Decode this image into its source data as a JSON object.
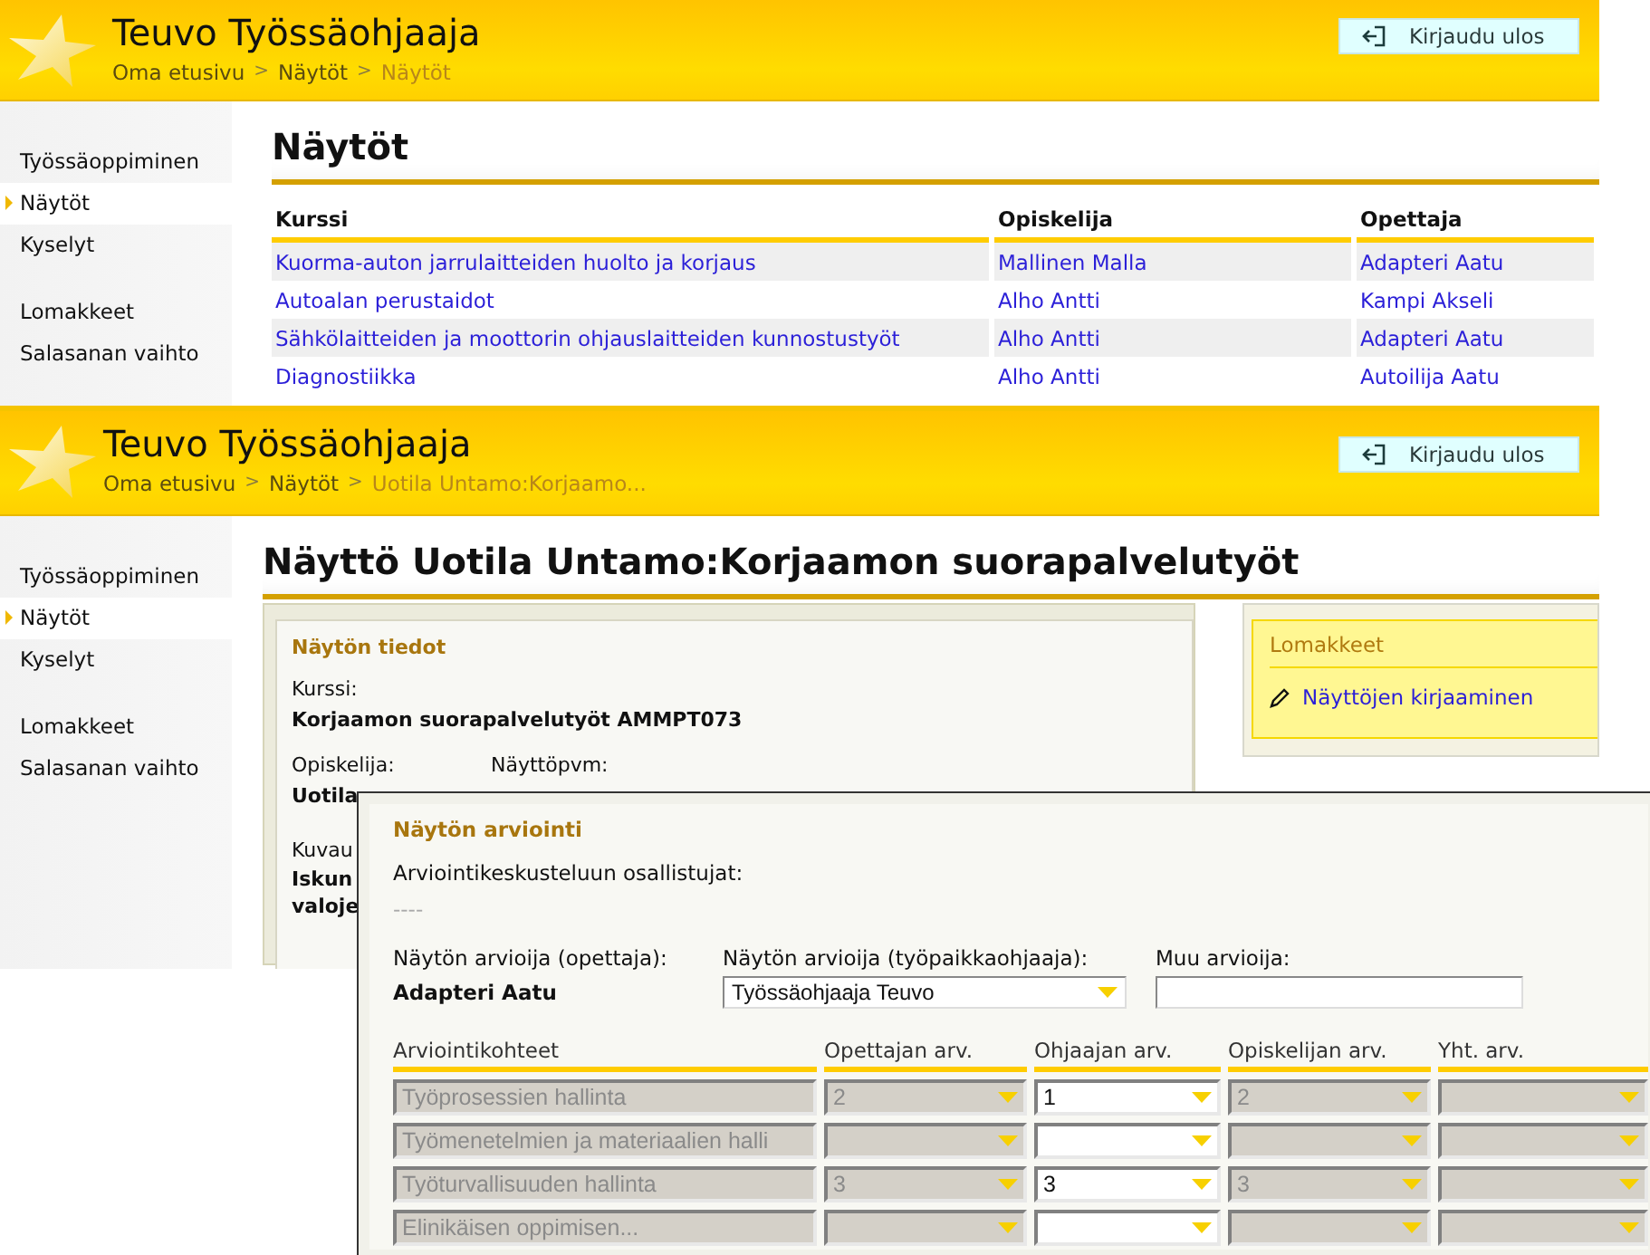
{
  "screens": [
    {
      "kind": "list",
      "header": {
        "title": "Teuvo Työssäohjaaja",
        "breadcrumb": {
          "separator": ">",
          "items": [
            {
              "text": "Oma etusivu",
              "current": false
            },
            {
              "text": "Näytöt",
              "current": false
            },
            {
              "text": "Näytöt",
              "current": true
            }
          ]
        },
        "logout": "Kirjaudu ulos"
      },
      "sidebar": [
        {
          "items": [
            {
              "label": "Työssäoppiminen",
              "selected": false
            },
            {
              "label": "Näytöt",
              "selected": true
            },
            {
              "label": "Kyselyt",
              "selected": false
            }
          ]
        },
        {
          "items": [
            {
              "label": "Lomakkeet",
              "selected": false
            },
            {
              "label": "Salasanan vaihto",
              "selected": false
            }
          ]
        }
      ],
      "page_title": "Näytöt",
      "table": {
        "columns": [
          "Kurssi",
          "Opiskelija",
          "Opettaja"
        ],
        "rows": [
          [
            "Kuorma-auton jarrulaitteiden huolto ja korjaus",
            "Mallinen Malla",
            "Adapteri Aatu"
          ],
          [
            "Autoalan perustaidot",
            "Alho Antti",
            "Kampi Akseli"
          ],
          [
            "Sähkölaitteiden ja moottorin ohjauslaitteiden kunnostustyöt",
            "Alho Antti",
            "Adapteri Aatu"
          ],
          [
            "Diagnostiikka",
            "Alho Antti",
            "Autoilija Aatu"
          ]
        ]
      }
    },
    {
      "kind": "detail",
      "header": {
        "title": "Teuvo Työssäohjaaja",
        "breadcrumb": {
          "separator": ">",
          "items": [
            {
              "text": "Oma etusivu",
              "current": false
            },
            {
              "text": "Näytöt",
              "current": false
            },
            {
              "text": "Uotila Untamo:Korjaamo...",
              "current": true
            }
          ]
        },
        "logout": "Kirjaudu ulos"
      },
      "sidebar": [
        {
          "items": [
            {
              "label": "Työssäoppiminen",
              "selected": false
            },
            {
              "label": "Näytöt",
              "selected": true
            },
            {
              "label": "Kyselyt",
              "selected": false
            }
          ]
        },
        {
          "items": [
            {
              "label": "Lomakkeet",
              "selected": false
            },
            {
              "label": "Salasanan vaihto",
              "selected": false
            }
          ]
        }
      ],
      "page_title": "Näyttö Uotila Untamo:Korjaamon suorapalvelutyöt",
      "info": {
        "title": "Näytön tiedot",
        "course_label": "Kurssi:",
        "course": "Korjaamon suorapalvelutyöt AMMPT073",
        "student_label": "Opiskelija:",
        "date_label": "Näyttöpvm:",
        "student": "Uotila",
        "description_label": "Kuvau",
        "description": [
          "Iskun",
          "valoje"
        ]
      },
      "forms_box": {
        "title": "Lomakkeet",
        "links": [
          "Näyttöjen kirjaaminen"
        ]
      }
    }
  ],
  "evaluation": {
    "title": "Näytön arviointi",
    "participants_label": "Arviointikeskusteluun osallistujat:",
    "participants": "----",
    "assessors": [
      {
        "kind": "text",
        "label": "Näytön arvioija (opettaja):",
        "value": "Adapteri Aatu"
      },
      {
        "kind": "select",
        "label": "Näytön arvioija (työpaikkaohjaaja):",
        "value": "Työssäohjaaja Teuvo"
      },
      {
        "kind": "input",
        "label": "Muu arvioija:"
      }
    ],
    "columns": [
      "Arviointikohteet",
      "Opettajan arv.",
      "Ohjaajan arv.",
      "Opiskelijan arv.",
      "Yht. arv."
    ],
    "rows": [
      {
        "target": "Työprosessien hallinta",
        "disabled": true,
        "grades": [
          {
            "value": "2",
            "disabled": true
          },
          {
            "value": "1",
            "disabled": false
          },
          {
            "value": "2",
            "disabled": true
          },
          {
            "disabled": true
          }
        ]
      },
      {
        "target": "Työmenetelmien ja materiaalien halli",
        "disabled": true,
        "grades": [
          {
            "disabled": true
          },
          {
            "disabled": false
          },
          {
            "disabled": true
          },
          {
            "disabled": true
          }
        ]
      },
      {
        "target": "Työturvallisuuden hallinta",
        "disabled": true,
        "grades": [
          {
            "value": "3",
            "disabled": true
          },
          {
            "value": "3",
            "disabled": false
          },
          {
            "value": "3",
            "disabled": true
          },
          {
            "disabled": true
          }
        ]
      },
      {
        "target": "Elinikäisen oppimisen...",
        "disabled": true,
        "grades": [
          {
            "disabled": true
          },
          {
            "disabled": false
          },
          {
            "disabled": true
          },
          {
            "disabled": true
          }
        ]
      }
    ]
  }
}
